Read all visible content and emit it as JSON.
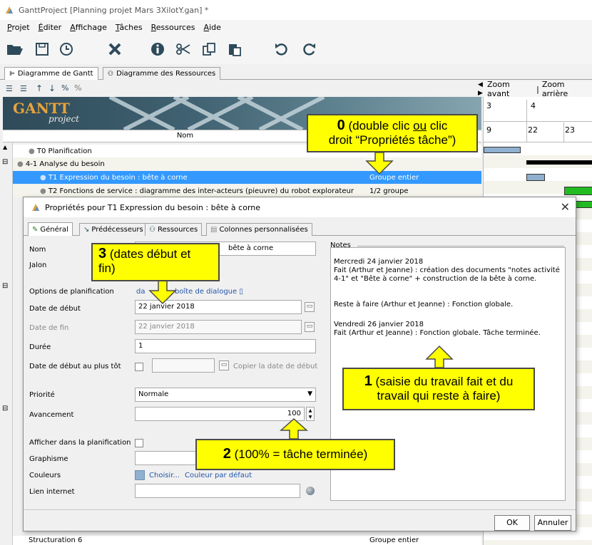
{
  "window": {
    "title": "GanttProject [Planning projet Mars 3XilotY.gan] *"
  },
  "menu": [
    "Projet",
    "Éditer",
    "Affichage",
    "Tâches",
    "Ressources",
    "Aide"
  ],
  "toolbar": {
    "icons": [
      "open-folder-icon",
      "save-icon",
      "clock-icon",
      "delete-icon",
      "info-icon",
      "cut-icon",
      "copy-icon",
      "paste-icon",
      "undo-icon",
      "redo-icon"
    ]
  },
  "main_tabs": [
    "Diagramme de Gantt",
    "Diagramme des Ressources"
  ],
  "gantt": {
    "banner_logo": "GANTT",
    "banner_sub": "project",
    "column_name": "Nom",
    "zoom_in": "Zoom avant",
    "zoom_sep": "|",
    "zoom_out": "Zoom arrière",
    "week_nums": [
      "3",
      "4"
    ],
    "day_nums": [
      "9",
      "22",
      "23"
    ],
    "rows": [
      {
        "name": "T0 Planification",
        "res": ""
      },
      {
        "name": "4-1 Analyse du besoin",
        "res": ""
      },
      {
        "name": "T1 Expression du besoin : bête à corne",
        "res": "Groupe entier"
      },
      {
        "name": "T2 Fonctions de service : diagramme des inter-acteurs (pieuvre) du robot explorateur",
        "res": "1/2 groupe"
      },
      {
        "name": "Structuration 6",
        "res": "Groupe entier"
      }
    ]
  },
  "dialog": {
    "title": "Propriétés pour T1 Expression du besoin : bête à corne",
    "close": "✕",
    "tabs": [
      "Général",
      "Prédécesseurs",
      "Ressources",
      "Colonnes personnalisées"
    ],
    "labels": {
      "nom": "Nom",
      "jalon": "Jalon",
      "options": "Options de planification",
      "debut": "Date de début",
      "fin": "Date de fin",
      "duree": "Durée",
      "plus_tot": "Date de début au plus tôt",
      "priorite": "Priorité",
      "avancement": "Avancement",
      "afficher": "Afficher dans la planification",
      "graphisme": "Graphisme",
      "couleurs": "Couleurs",
      "lien": "Lien internet"
    },
    "values": {
      "nom_visible": "bête à corne",
      "options_link_start": "da",
      "options_link_end": "boîte de dialogue ▯",
      "debut": "22 janvier 2018",
      "fin": "22 janvier 2018",
      "duree": "1",
      "copy_start": "Copier la date de début",
      "priorite": "Normale",
      "avancement": "100",
      "choisir": "Choisir...",
      "couleur_defaut": "Couleur par défaut"
    },
    "notes_title": "Notes",
    "notes": [
      "Mercredi 24 janvier 2018",
      "Fait (Arthur et Jeanne) : création des documents \"notes activité 4-1\" et \"Bête à corne\" + construction de la bête à corne.",
      "Reste à faire (Arthur et Jeanne) : Fonction globale.",
      "Vendredi 26 janvier 2018",
      "Fait (Arthur et Jeanne) : Fonction globale. Tâche terminée."
    ],
    "ok": "OK",
    "cancel": "Annuler"
  },
  "annotations": {
    "a0_num": "0",
    "a0_l1a": " (double clic ",
    "a0_ou": "ou",
    "a0_l1b": " clic",
    "a0_l2": "droit “Propriétés tâche”)",
    "a1_num": "1",
    "a1_l1": " (saisie du travail fait et du",
    "a1_l2": "travail qui reste à faire)",
    "a2_num": "2",
    "a2_text": " (100% = tâche terminée)",
    "a3_num": "3",
    "a3_l1": " (dates début et",
    "a3_l2": "fin)"
  },
  "colors": {
    "selection": "#3399ff",
    "annotation": "#ffff00",
    "bar_green": "#22bb22",
    "bar_blue": "#8fb0cf"
  }
}
